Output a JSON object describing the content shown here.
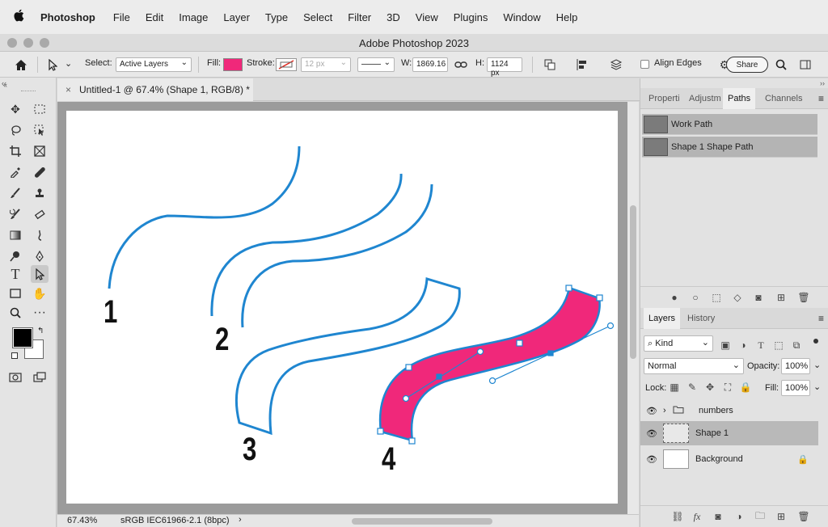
{
  "menubar": {
    "app_name": "Photoshop",
    "items": [
      "File",
      "Edit",
      "Image",
      "Layer",
      "Type",
      "Select",
      "Filter",
      "3D",
      "View",
      "Plugins",
      "Window",
      "Help"
    ]
  },
  "window": {
    "title": "Adobe Photoshop 2023"
  },
  "options": {
    "select_label": "Select:",
    "select_value": "Active Layers",
    "fill_label": "Fill:",
    "stroke_label": "Stroke:",
    "stroke_width": "12 px",
    "w_label": "W:",
    "w_value": "1869.16",
    "h_label": "H:",
    "h_value": "1124 px",
    "align_edges": "Align Edges",
    "share": "Share",
    "fill_color": "#f0287a"
  },
  "document": {
    "tab_title": "Untitled-1 @ 67.4% (Shape 1, RGB/8) *",
    "numbers": [
      "1",
      "2",
      "3",
      "4"
    ],
    "stroke_color": "#1f86d0",
    "shape_fill": "#f0287a"
  },
  "status": {
    "zoom": "67.43%",
    "profile": "sRGB IEC61966-2.1 (8bpc)"
  },
  "top_panel": {
    "tabs": [
      "Properti",
      "Adjustm",
      "Paths",
      "Channels"
    ],
    "active_tab": "Paths",
    "paths": [
      "Work Path",
      "Shape 1 Shape Path"
    ]
  },
  "layers_panel": {
    "tabs": [
      "Layers",
      "History"
    ],
    "kind": "Kind",
    "blend_mode": "Normal",
    "opacity_label": "Opacity:",
    "opacity": "100%",
    "lock_label": "Lock:",
    "fill_label": "Fill:",
    "fill": "100%",
    "layers": [
      "numbers",
      "Shape 1",
      "Background"
    ]
  }
}
